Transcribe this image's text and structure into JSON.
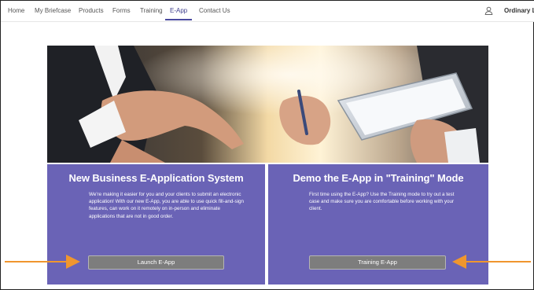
{
  "nav": {
    "items": [
      {
        "label": "Home"
      },
      {
        "label": "My Briefcase"
      },
      {
        "label": "Products"
      },
      {
        "label": "Forms"
      },
      {
        "label": "Training"
      },
      {
        "label": "E-App"
      },
      {
        "label": "Contact Us"
      }
    ],
    "active_item": "E-App",
    "user_icon": "user-icon",
    "user_name": "Ordinary Life"
  },
  "hero": {
    "icon": "business-meeting-tablet-photo"
  },
  "cards": {
    "new_business": {
      "title": "New Business E-Application System",
      "body": "We're making it easier for you and your clients to submit an electronic application! With our new E-App, you are able to use quick fill-and-sign features, can work on it remotely on in-person and eliminate applications that are not in good order.",
      "button_label": "Launch E-App"
    },
    "demo": {
      "title": "Demo the E-App in \"Training\" Mode",
      "body": "First time using the E-App? Use the Training mode to try out a test case and make sure you are comfortable before working with your client.",
      "button_label": "Training E-App"
    }
  },
  "colors": {
    "card_background": "#6a63b6",
    "button_background": "#7d7d7d",
    "arrow": "#f0962e",
    "nav_active": "#3d3d8c"
  }
}
